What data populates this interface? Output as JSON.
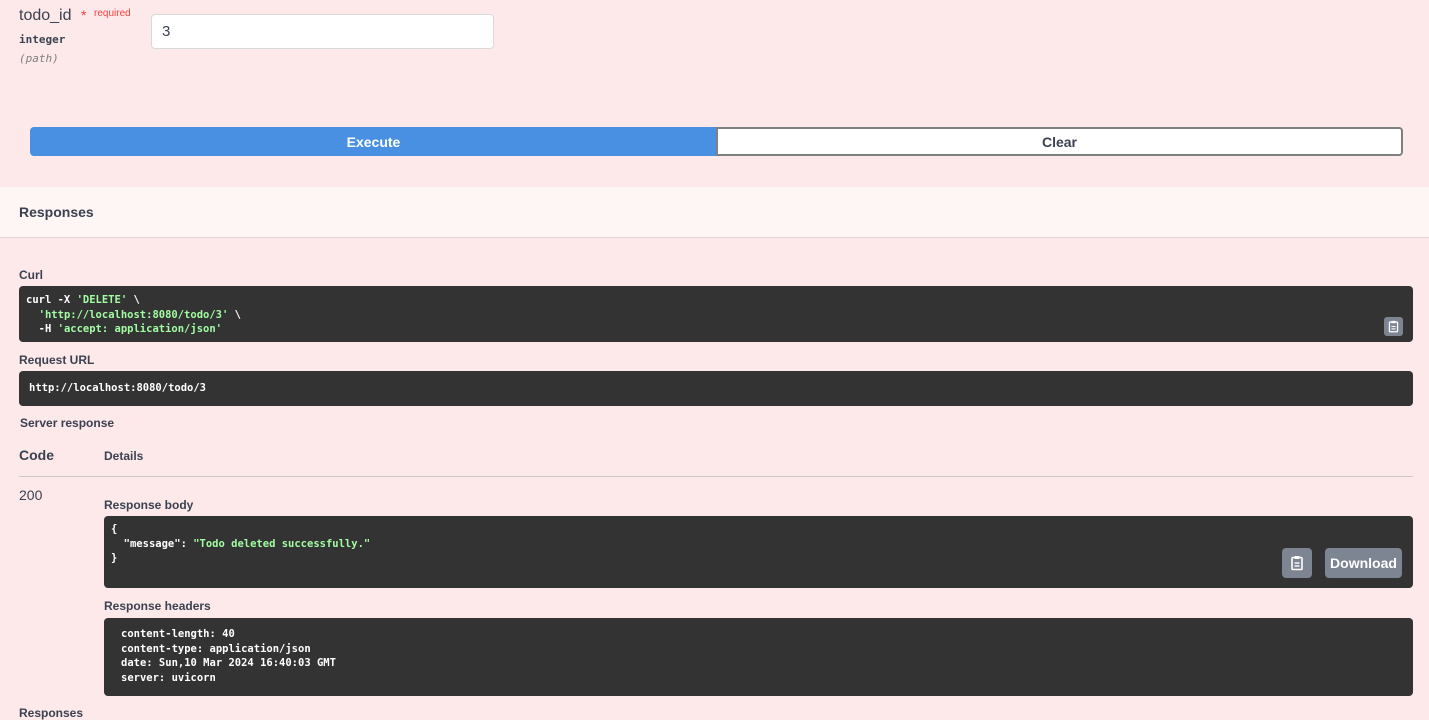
{
  "parameter": {
    "name": "todo_id",
    "required_star": "*",
    "required_label": "required",
    "type": "integer",
    "location": "(path)",
    "value": "3"
  },
  "actions": {
    "execute_label": "Execute",
    "clear_label": "Clear"
  },
  "responses_section": {
    "title": "Responses",
    "curl_label": "Curl",
    "curl": {
      "line1_cmd": "curl -X ",
      "line1_method": "'DELETE'",
      "line1_tail": " \\",
      "line2_url": "'http://localhost:8080/todo/3'",
      "line2_tail": " \\",
      "line3_flag": "-H ",
      "line3_header": "'accept: application/json'"
    },
    "request_url_label": "Request URL",
    "request_url": "http://localhost:8080/todo/3",
    "server_response_label": "Server response",
    "code_header": "Code",
    "details_header": "Details",
    "status_code": "200",
    "response_body_label": "Response body",
    "response_body": {
      "open": "{",
      "key": "\"message\"",
      "sep": ": ",
      "value": "\"Todo deleted successfully.\"",
      "close": "}"
    },
    "download_label": "Download",
    "response_headers_label": "Response headers",
    "response_headers": [
      "content-length: 40",
      "content-type: application/json",
      "date: Sun,10 Mar 2024 16:40:03 GMT",
      "server: uvicorn"
    ],
    "next_section_title": "Responses"
  },
  "icons": {
    "copy": "clipboard-copy-icon"
  },
  "colors": {
    "execute": "#4990e2",
    "background": "#fde9e9",
    "code_bg": "#333333",
    "string": "#a2fca2",
    "required": "#f93e3e"
  }
}
